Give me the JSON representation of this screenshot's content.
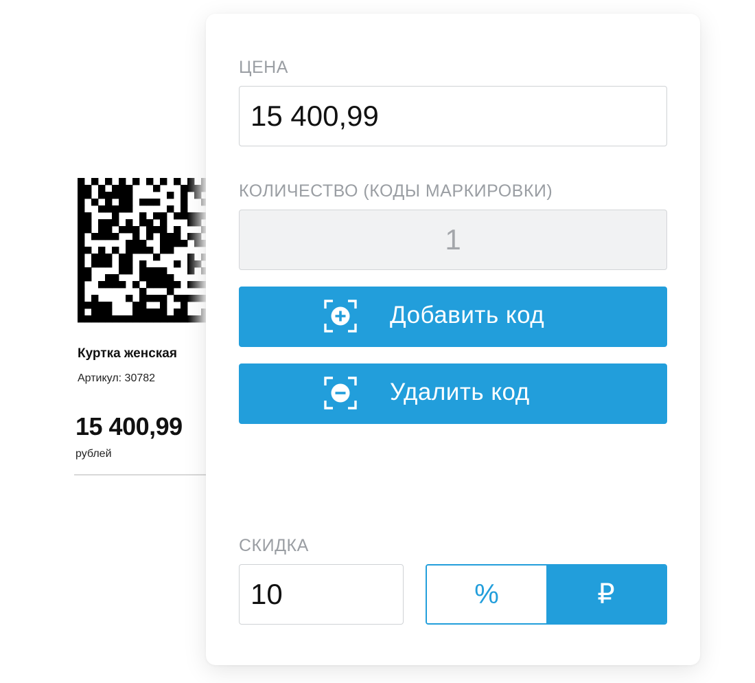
{
  "product": {
    "name": "Куртка женская",
    "sku": "Артикул: 30782",
    "price": "15 400,99",
    "currency": "рублей"
  },
  "form": {
    "price": {
      "label": "ЦЕНА",
      "value": "15 400,99"
    },
    "quantity": {
      "label": "КОЛИЧЕСТВО (КОДЫ МАРКИРОВКИ)",
      "value": "1"
    },
    "add_code_button": {
      "label": "Добавить код",
      "icon": "scan-plus-icon"
    },
    "remove_code_button": {
      "label": "Удалить код",
      "icon": "scan-minus-icon"
    },
    "discount": {
      "label": "СКИДКА",
      "value": "10",
      "options": [
        {
          "label": "%",
          "selected": false
        },
        {
          "label": "₽",
          "selected": true
        }
      ]
    }
  },
  "colors": {
    "accent": "#229edb",
    "label": "#9a9ea3",
    "disabled_bg": "#f1f2f3"
  }
}
